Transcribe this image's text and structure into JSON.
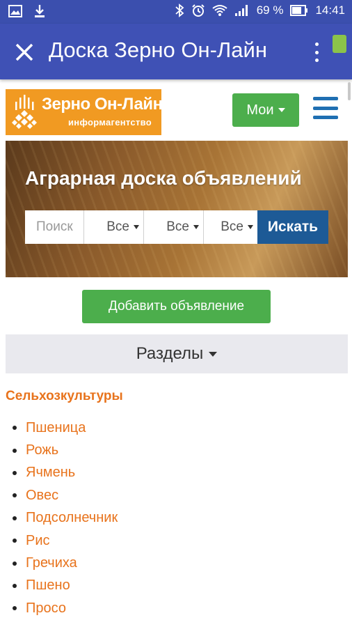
{
  "status_bar": {
    "battery_percent": "69 %",
    "time": "14:41",
    "icons": [
      "gallery-icon",
      "download-icon",
      "bluetooth-icon",
      "alarm-icon",
      "wifi-icon",
      "signal-icon",
      "battery-icon"
    ]
  },
  "app_bar": {
    "title": "Доска Зерно Он-Лайн",
    "icons": [
      "close-icon",
      "overflow-menu-icon",
      "sim-card-icon"
    ]
  },
  "logo": {
    "name": "Зерно Он-Лайн",
    "subtitle": "информагентство"
  },
  "header": {
    "my_button": "Мои",
    "menu_icon": "hamburger-icon"
  },
  "hero": {
    "title": "Аграрная доска объявлений",
    "search_placeholder": "Поиск",
    "select1": "Все",
    "select2": "Все",
    "select3": "Все",
    "search_button": "Искать"
  },
  "add_button": "Добавить объявление",
  "sections": {
    "label": "Разделы"
  },
  "category": {
    "heading": "Сельхозкультуры",
    "items": [
      "Пшеница",
      "Рожь",
      "Ячмень",
      "Овес",
      "Подсолнечник",
      "Рис",
      "Гречиха",
      "Пшено",
      "Просо"
    ]
  },
  "colors": {
    "status_bar": "#3b4fae",
    "app_bar": "#3f51b5",
    "logo_bg": "#f19a22",
    "green_button": "#4cae4c",
    "search_button": "#1d5a96",
    "link_orange": "#e8731c",
    "hamburger": "#1f6fb2"
  }
}
